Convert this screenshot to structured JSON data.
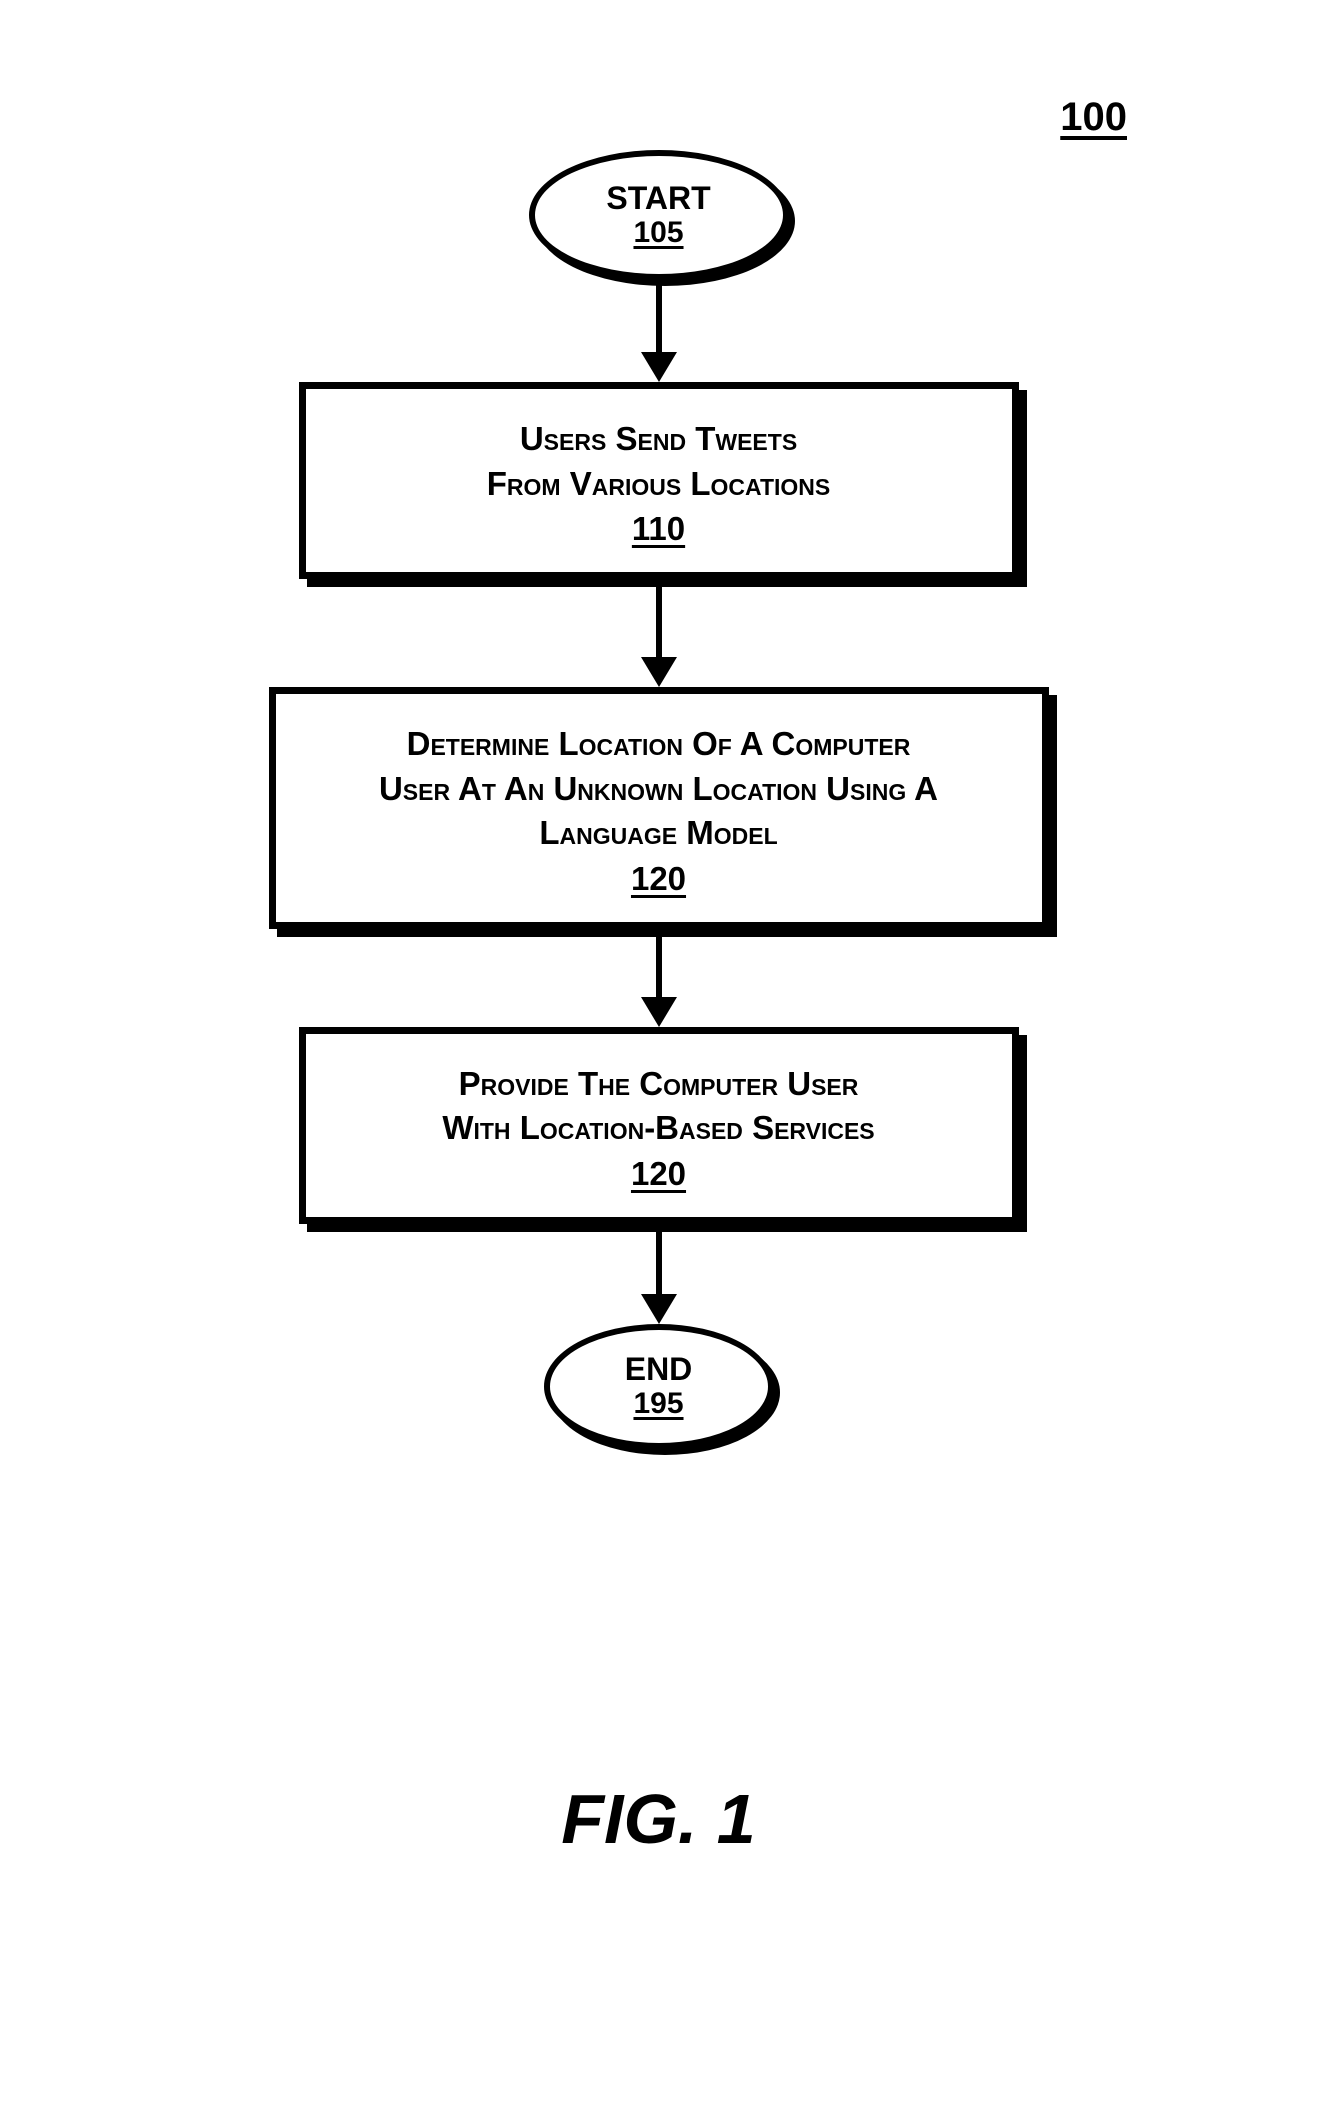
{
  "diagram_ref": "100",
  "start": {
    "label": "START",
    "ref": "105"
  },
  "step1": {
    "line1": "Users Send Tweets",
    "line2": "From Various Locations",
    "ref": "110"
  },
  "step2": {
    "line1": "Determine Location Of A Computer",
    "line2": "User At An Unknown Location Using A",
    "line3": "Language Model",
    "ref": "120"
  },
  "step3": {
    "line1": "Provide The Computer User",
    "line2": "With Location-Based Services",
    "ref": "120"
  },
  "end": {
    "label": "END",
    "ref": "195"
  },
  "caption": "FIG. 1"
}
